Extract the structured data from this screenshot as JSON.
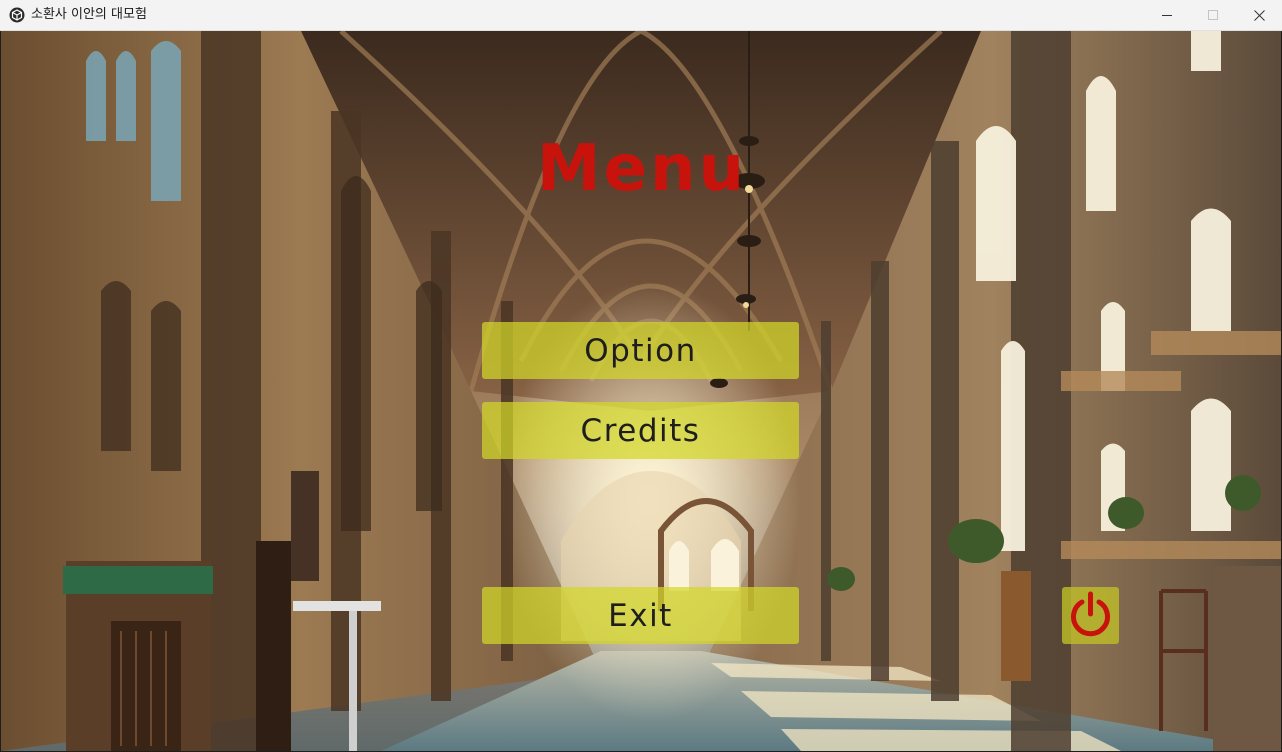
{
  "window": {
    "title": "소환사 이안의 대모험",
    "icon": "unity-cube-icon",
    "controls": [
      "minimize-icon",
      "maximize-icon",
      "close-icon"
    ]
  },
  "menu": {
    "title": "Menu",
    "title_color": "#c8130d",
    "buttons": {
      "option": "Option",
      "credits": "Credits",
      "exit": "Exit"
    },
    "button_color": "#d2d728",
    "power_icon": "power-icon",
    "power_icon_color": "#c8130d"
  }
}
